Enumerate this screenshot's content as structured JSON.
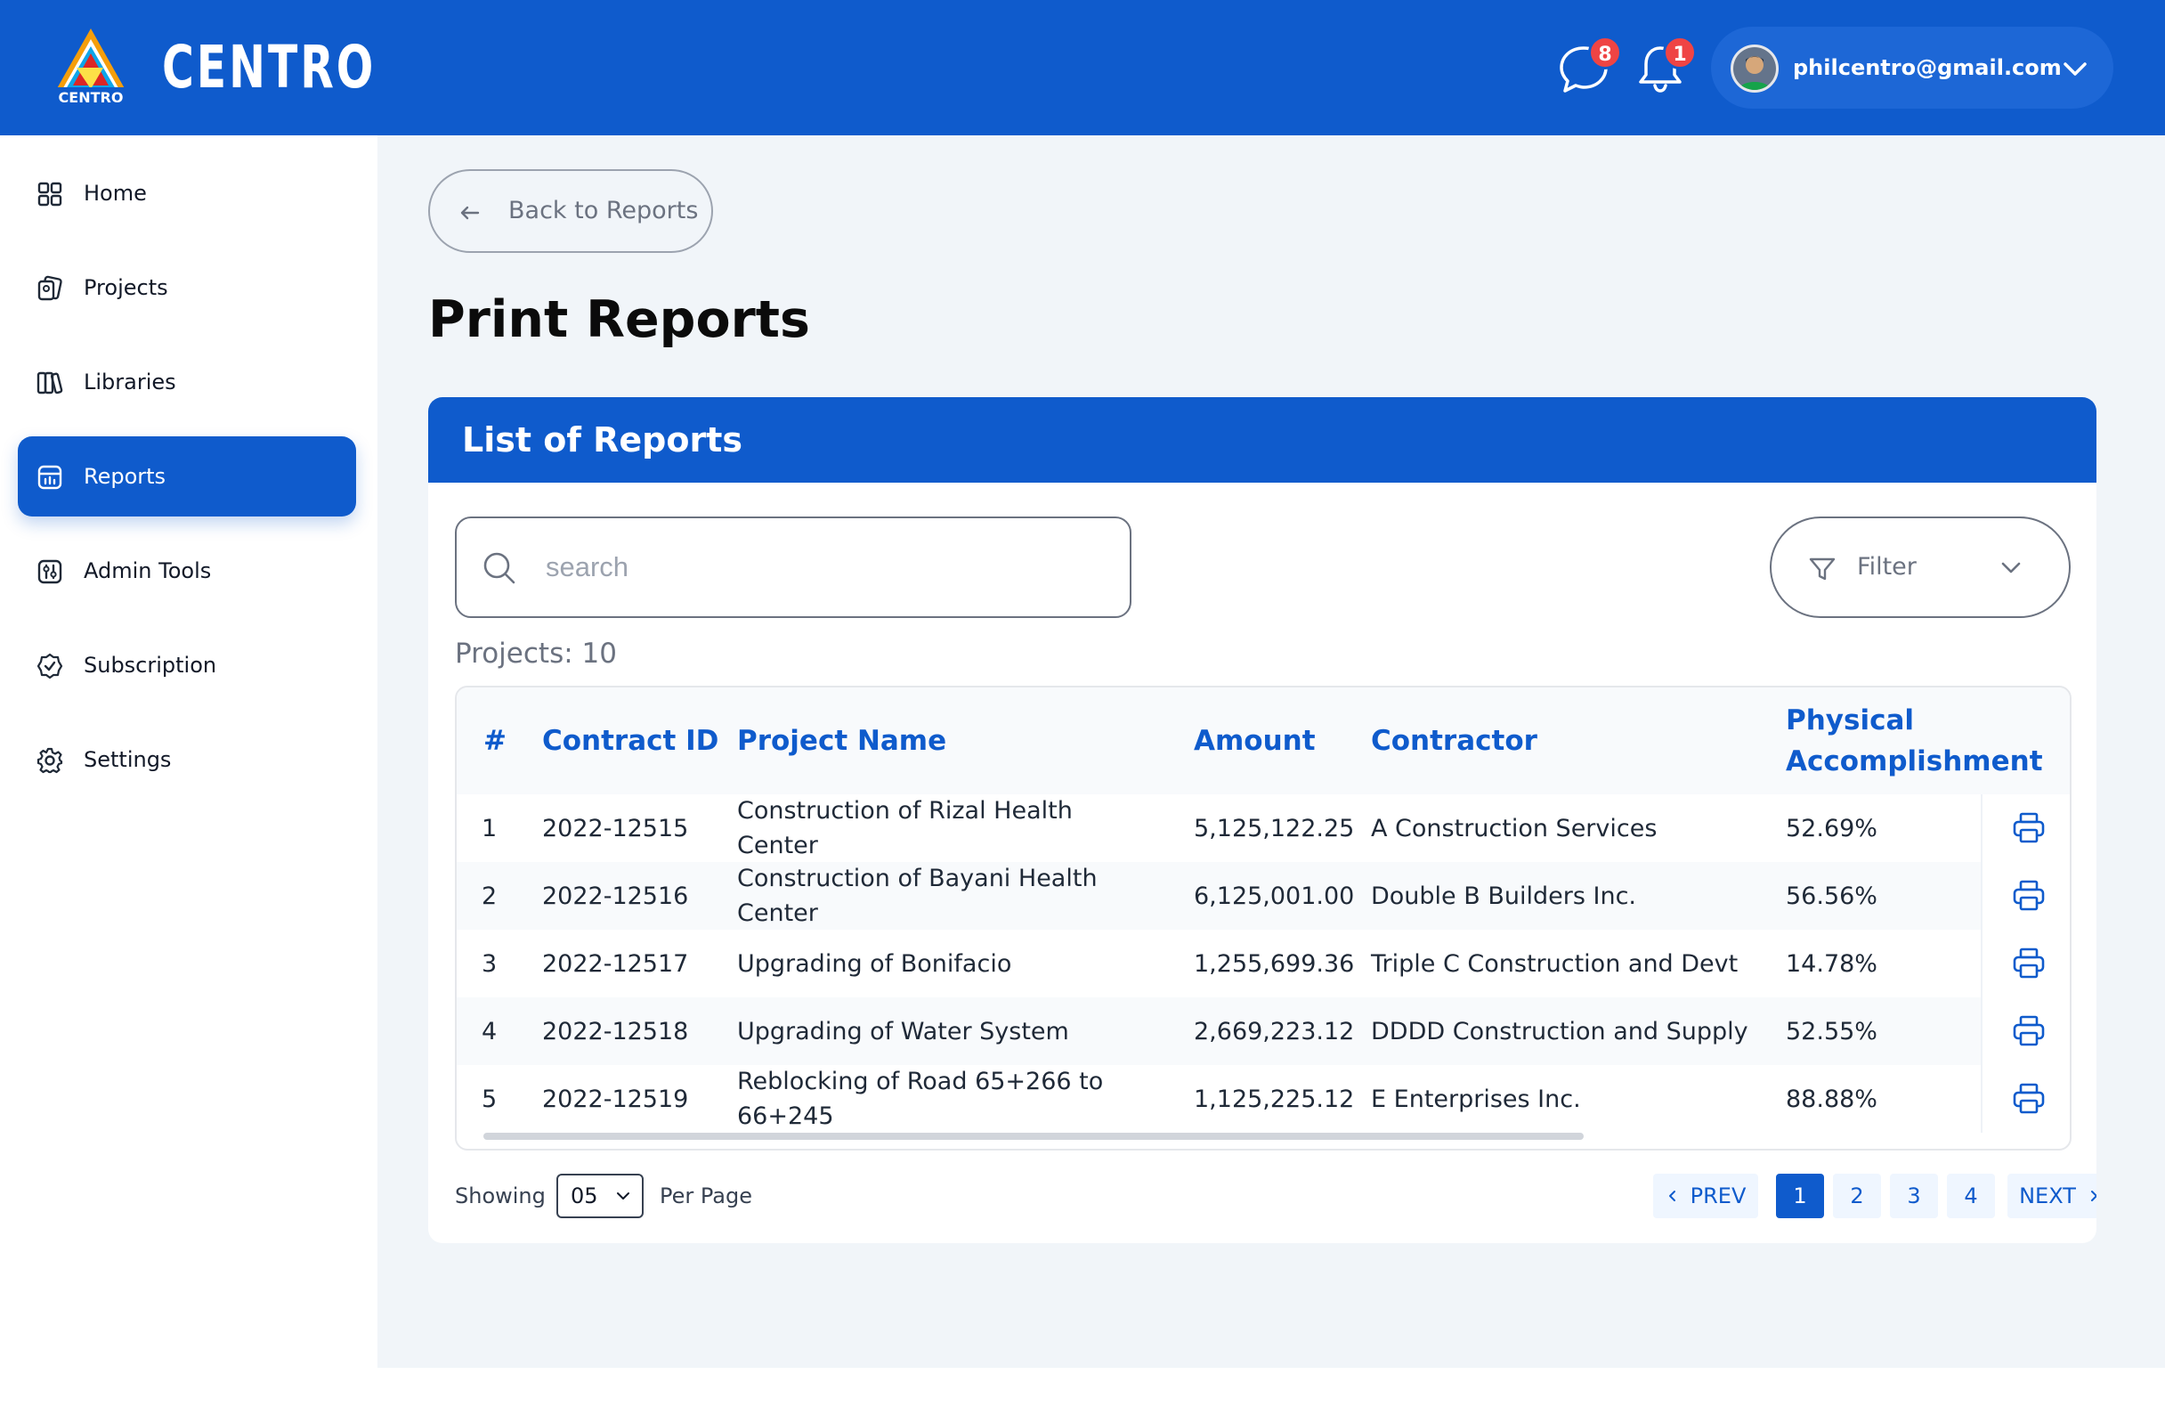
{
  "brand": {
    "name": "CENTRO",
    "logo_text": "CENTRO"
  },
  "header": {
    "messages_badge": "8",
    "notifications_badge": "1",
    "user_email": "philcentro@gmail.com"
  },
  "sidebar": {
    "items": [
      {
        "label": "Home",
        "icon": "grid-icon"
      },
      {
        "label": "Projects",
        "icon": "projects-icon"
      },
      {
        "label": "Libraries",
        "icon": "books-icon"
      },
      {
        "label": "Reports",
        "icon": "report-icon",
        "active": true
      },
      {
        "label": "Admin Tools",
        "icon": "tools-icon"
      },
      {
        "label": "Subscription",
        "icon": "badge-icon"
      },
      {
        "label": "Settings",
        "icon": "gear-icon"
      }
    ]
  },
  "main": {
    "back_label": "Back to Reports",
    "page_title": "Print Reports",
    "card_title": "List of Reports",
    "search_placeholder": "search",
    "search_value": "",
    "filter_label": "Filter",
    "projects_count": "Projects: 10"
  },
  "table": {
    "columns": [
      "#",
      "Contract ID",
      "Project Name",
      "Amount",
      "Contractor",
      "Physical Accomplishment"
    ],
    "rows": [
      {
        "num": "1",
        "contract_id": "2022-12515",
        "project": "Construction of Rizal Health Center",
        "amount": "5,125,122.25",
        "contractor": "A Construction Services",
        "accomplishment": "52.69%"
      },
      {
        "num": "2",
        "contract_id": "2022-12516",
        "project": "Construction of Bayani Health Center",
        "amount": "6,125,001.00",
        "contractor": "Double B Builders Inc.",
        "accomplishment": "56.56%"
      },
      {
        "num": "3",
        "contract_id": "2022-12517",
        "project": "Upgrading of Bonifacio",
        "amount": "1,255,699.36",
        "contractor": "Triple C Construction and Devt",
        "accomplishment": "14.78%"
      },
      {
        "num": "4",
        "contract_id": "2022-12518",
        "project": "Upgrading of Water System",
        "amount": "2,669,223.12",
        "contractor": "DDDD Construction and Supply",
        "accomplishment": "52.55%"
      },
      {
        "num": "5",
        "contract_id": "2022-12519",
        "project": "Reblocking of Road 65+266 to 66+245",
        "amount": "1,125,225.12",
        "contractor": "E Enterprises Inc.",
        "accomplishment": "88.88%"
      }
    ]
  },
  "pagination": {
    "showing_label": "Showing",
    "per_page_value": "05",
    "per_page_label": "Per Page",
    "prev_label": "PREV",
    "next_label": "NEXT",
    "pages": [
      "1",
      "2",
      "3",
      "4"
    ],
    "current_page": "1"
  },
  "colors": {
    "primary": "#0f5bcc",
    "badge": "#ef4444",
    "background": "#f1f5f9"
  }
}
